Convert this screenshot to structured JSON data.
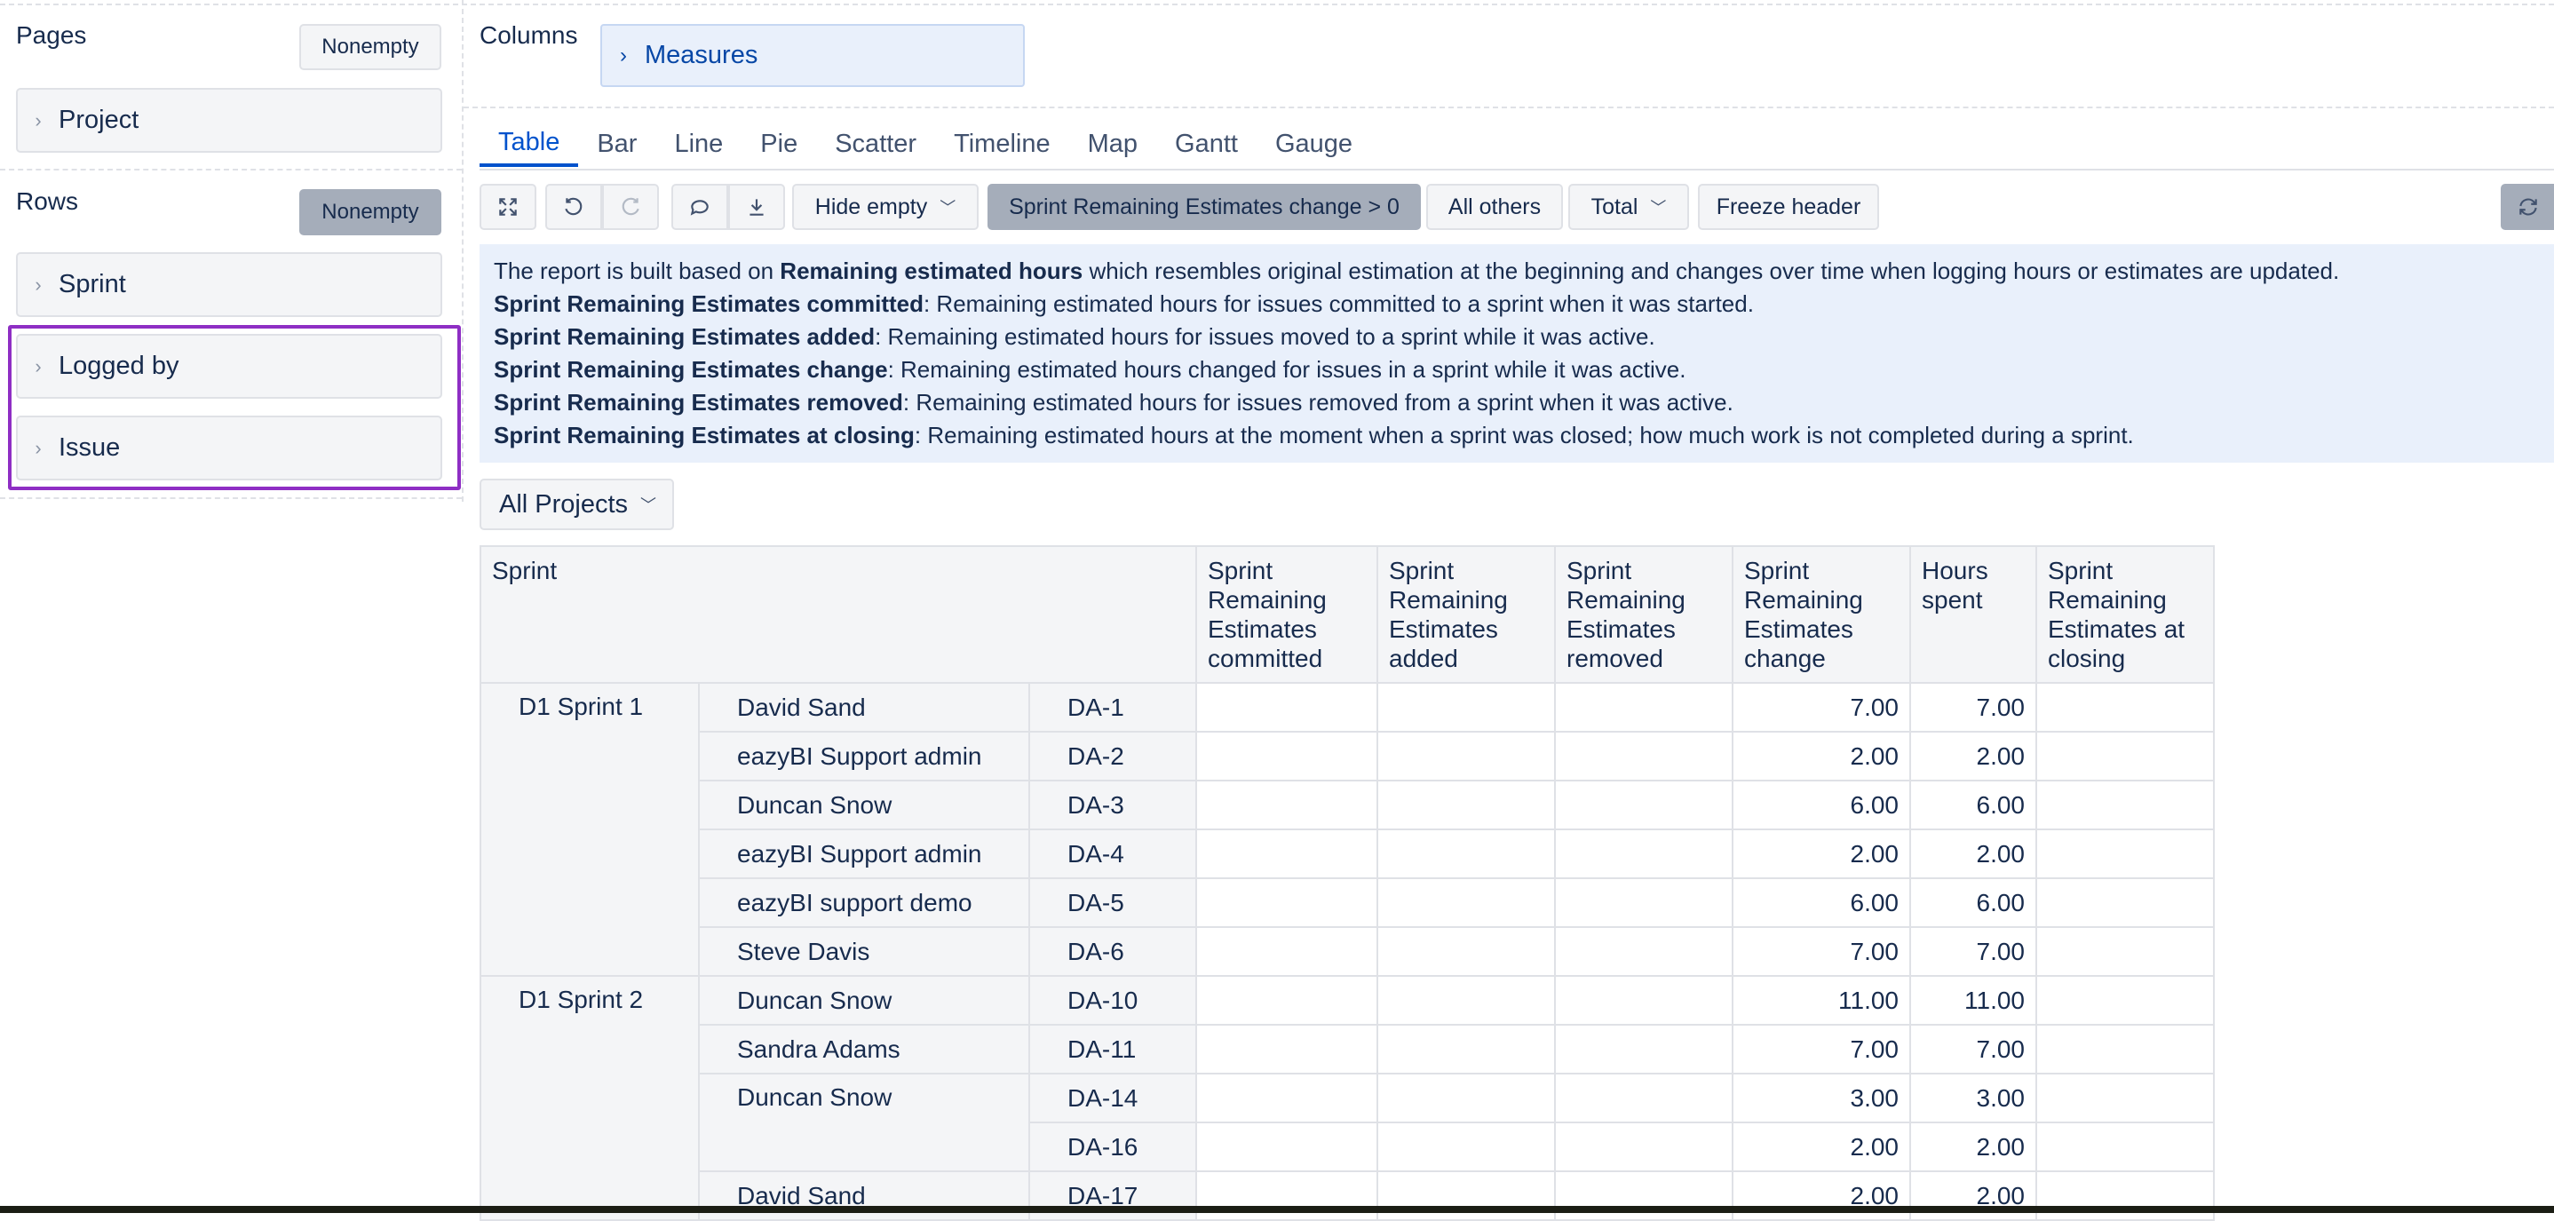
{
  "sidebar": {
    "pages": {
      "title": "Pages",
      "nonempty_label": "Nonempty",
      "items": [
        "Project"
      ]
    },
    "rows": {
      "title": "Rows",
      "nonempty_label": "Nonempty",
      "items": [
        "Sprint",
        "Logged by",
        "Issue"
      ]
    }
  },
  "columns": {
    "title": "Columns",
    "measures_label": "Measures"
  },
  "tabs": [
    "Table",
    "Bar",
    "Line",
    "Pie",
    "Scatter",
    "Timeline",
    "Map",
    "Gantt",
    "Gauge"
  ],
  "toolbar": {
    "hide_empty": "Hide empty",
    "filter_label": "Sprint Remaining Estimates change > 0",
    "all_others": "All others",
    "total": "Total",
    "freeze_header": "Freeze header"
  },
  "info": {
    "line1_pre": "The report is built based on ",
    "line1_bold": "Remaining estimated hours",
    "line1_post": " which resembles original estimation at the beginning and changes over time when logging hours or estimates are updated.",
    "lines": [
      {
        "bold": "Sprint Remaining Estimates committed",
        "text": ": Remaining estimated hours for issues committed to a sprint when it was started."
      },
      {
        "bold": "Sprint Remaining Estimates added",
        "text": ": Remaining estimated hours for issues moved to a sprint while it was active."
      },
      {
        "bold": "Sprint Remaining Estimates change",
        "text": ": Remaining estimated hours changed for issues in a sprint while it was active."
      },
      {
        "bold": "Sprint Remaining Estimates removed",
        "text": ": Remaining estimated hours for issues removed from a sprint when it was active."
      },
      {
        "bold": "Sprint Remaining Estimates at closing",
        "text": ": Remaining estimated hours at the moment when a sprint was closed; how much work is not completed during a sprint."
      }
    ]
  },
  "project_selector": "All Projects",
  "table": {
    "row_header": "Sprint",
    "columns": [
      "Sprint Remaining Estimates committed",
      "Sprint Remaining Estimates added",
      "Sprint Remaining Estimates removed",
      "Sprint Remaining Estimates change",
      "Hours spent",
      "Sprint Remaining Estimates at closing"
    ],
    "sprints": [
      "D1 Sprint 1",
      "D1 Sprint 2"
    ],
    "rows": [
      {
        "person": "David Sand",
        "issue": "DA-1",
        "change": "7.00",
        "hours": "7.00"
      },
      {
        "person": "eazyBI Support admin",
        "issue": "DA-2",
        "change": "2.00",
        "hours": "2.00"
      },
      {
        "person": "Duncan Snow",
        "issue": "DA-3",
        "change": "6.00",
        "hours": "6.00"
      },
      {
        "person": "eazyBI Support admin",
        "issue": "DA-4",
        "change": "2.00",
        "hours": "2.00"
      },
      {
        "person": "eazyBI support demo",
        "issue": "DA-5",
        "change": "6.00",
        "hours": "6.00"
      },
      {
        "person": "Steve Davis",
        "issue": "DA-6",
        "change": "7.00",
        "hours": "7.00"
      },
      {
        "person": "Duncan Snow",
        "issue": "DA-10",
        "change": "11.00",
        "hours": "11.00"
      },
      {
        "person": "Sandra Adams",
        "issue": "DA-11",
        "change": "7.00",
        "hours": "7.00"
      },
      {
        "person": "Duncan Snow",
        "issue": "DA-14",
        "change": "3.00",
        "hours": "3.00"
      },
      {
        "person": "",
        "issue": "DA-16",
        "change": "2.00",
        "hours": "2.00"
      },
      {
        "person": "David Sand",
        "issue": "DA-17",
        "change": "2.00",
        "hours": "2.00"
      }
    ]
  },
  "colors": {
    "accent": "#0052cc",
    "highlight": "#8e2ec4",
    "info_bg": "#e9f0fb"
  }
}
